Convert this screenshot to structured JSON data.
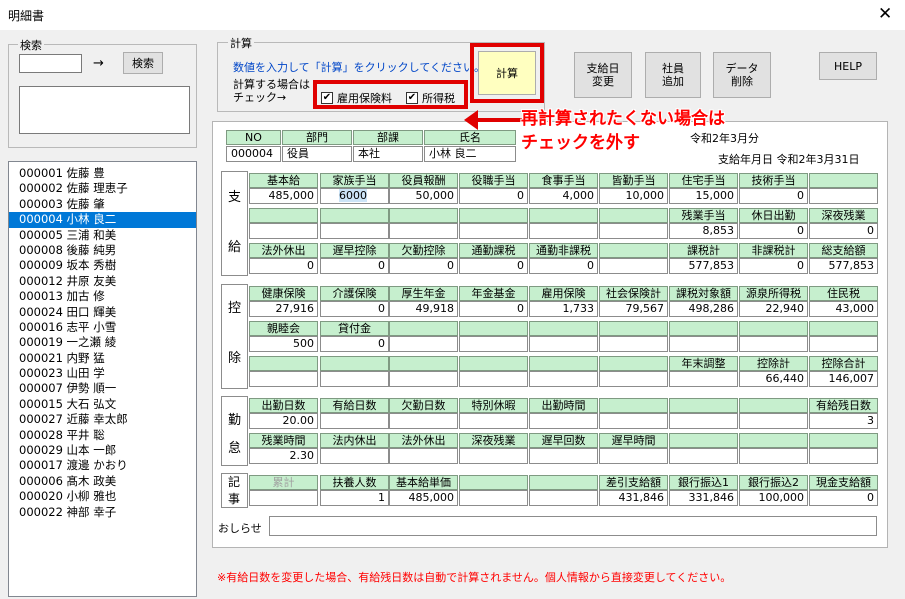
{
  "window": {
    "title": "明細書",
    "close_glyph": "✕"
  },
  "search": {
    "group_label": "検索",
    "arrow": "→",
    "button_label": "検索"
  },
  "calc": {
    "group_label": "計算",
    "instruction": "数値を入力して「計算」をクリックしてください。",
    "when_label_line1": "計算する場合は",
    "when_label_line2": "チェック→",
    "check_insurance": "雇用保険料",
    "check_tax": "所得税",
    "button_label": "計算"
  },
  "buttons": {
    "pay_date_change": [
      "支給日",
      "変更"
    ],
    "add_employee": [
      "社員",
      "追加"
    ],
    "delete_data": [
      "データ",
      "削除"
    ],
    "help": "HELP"
  },
  "callout": {
    "line1": "再計算されたくない場合は",
    "line2": "チェックを外す"
  },
  "employees": [
    "000001 佐藤 豊",
    "000002 佐藤 理恵子",
    "000003 佐藤 肇",
    "000004 小林 良二",
    "000005 三浦  和美",
    "000008 後藤 純男",
    "000009 坂本 秀樹",
    "000012 井原 友美",
    "000013 加古 修",
    "000024 田口 輝美",
    "000016 志平 小雪",
    "000019 一之瀬 綾",
    "000021 内野 猛",
    "000023 山田 学",
    "000007 伊勢  順一",
    "000015 大石 弘文",
    "000027 近藤 幸太郎",
    "000028 平井 聡",
    "000029 山本 一郎",
    "000017 渡邊 かおり",
    "000006 髙木 政美",
    "000020 小柳 雅也",
    "000022 神部 幸子"
  ],
  "selected_employee_index": 3,
  "info": {
    "headers": [
      "NO",
      "部門",
      "部課",
      "氏名"
    ],
    "values": [
      "000004",
      "役員",
      "本社",
      "小林 良二"
    ],
    "month": "令和2年3月分",
    "pay_date": "支給年月日 令和2年3月31日"
  },
  "payment": {
    "label": [
      "支",
      "給"
    ],
    "row1_h": [
      "基本給",
      "家族手当",
      "役員報酬",
      "役職手当",
      "食事手当",
      "皆勤手当",
      "住宅手当",
      "技術手当",
      ""
    ],
    "row1_v": [
      "485,000",
      "6000",
      "50,000",
      "0",
      "4,000",
      "10,000",
      "15,000",
      "0",
      ""
    ],
    "row2_h": [
      "",
      "",
      "",
      "",
      "",
      "",
      "残業手当",
      "休日出勤",
      "深夜残業"
    ],
    "row2_v": [
      "",
      "",
      "",
      "",
      "",
      "",
      "8,853",
      "0",
      "0"
    ],
    "row3_h": [
      "法外休出",
      "遅早控除",
      "欠勤控除",
      "通勤課税",
      "通勤非課税",
      "",
      "課税計",
      "非課税計",
      "総支給額"
    ],
    "row3_v": [
      "0",
      "0",
      "0",
      "0",
      "0",
      "",
      "577,853",
      "0",
      "577,853"
    ]
  },
  "deduction": {
    "label": [
      "控",
      "除"
    ],
    "row1_h": [
      "健康保険",
      "介護保険",
      "厚生年金",
      "年金基金",
      "雇用保険",
      "社会保険計",
      "課税対象額",
      "源泉所得税",
      "住民税"
    ],
    "row1_v": [
      "27,916",
      "0",
      "49,918",
      "0",
      "1,733",
      "79,567",
      "498,286",
      "22,940",
      "43,000"
    ],
    "row2_h": [
      "親睦会",
      "貸付金",
      "",
      "",
      "",
      "",
      "",
      "",
      ""
    ],
    "row2_v": [
      "500",
      "0",
      "",
      "",
      "",
      "",
      "",
      "",
      ""
    ],
    "row3_h": [
      "",
      "",
      "",
      "",
      "",
      "",
      "年末調整",
      "控除計",
      "控除合計"
    ],
    "row3_v": [
      "",
      "",
      "",
      "",
      "",
      "",
      "",
      "66,440",
      "146,007"
    ]
  },
  "attendance": {
    "label": [
      "勤",
      "怠"
    ],
    "row1_h": [
      "出勤日数",
      "有給日数",
      "欠勤日数",
      "特別休暇",
      "出勤時間",
      "",
      "",
      "",
      "有給残日数"
    ],
    "row1_v": [
      "20.00",
      "",
      "",
      "",
      "",
      "",
      "",
      "",
      "3"
    ],
    "row2_h": [
      "残業時間",
      "法内休出",
      "法外休出",
      "深夜残業",
      "遅早回数",
      "遅早時間",
      "",
      "",
      ""
    ],
    "row2_v": [
      "2.30",
      "",
      "",
      "",
      "",
      "",
      "",
      "",
      ""
    ]
  },
  "record": {
    "label": [
      "記",
      "事"
    ],
    "row1_h": [
      "累計",
      "扶養人数",
      "基本給単価",
      "",
      "",
      "差引支給額",
      "銀行振込1",
      "銀行振込2",
      "現金支給額"
    ],
    "row1_v": [
      "",
      "1",
      "485,000",
      "",
      "",
      "431,846",
      "331,846",
      "100,000",
      "0"
    ]
  },
  "notice_label": "おしらせ",
  "footer_note": "※有給日数を変更した場合、有給残日数は自動で計算されません。個人情報から直接変更してください。",
  "colors": {
    "highlight_red": "#e00000",
    "header_green": "#c6efce",
    "selection_blue": "#0078d7",
    "calc_button_yellow": "#ffffc0"
  }
}
